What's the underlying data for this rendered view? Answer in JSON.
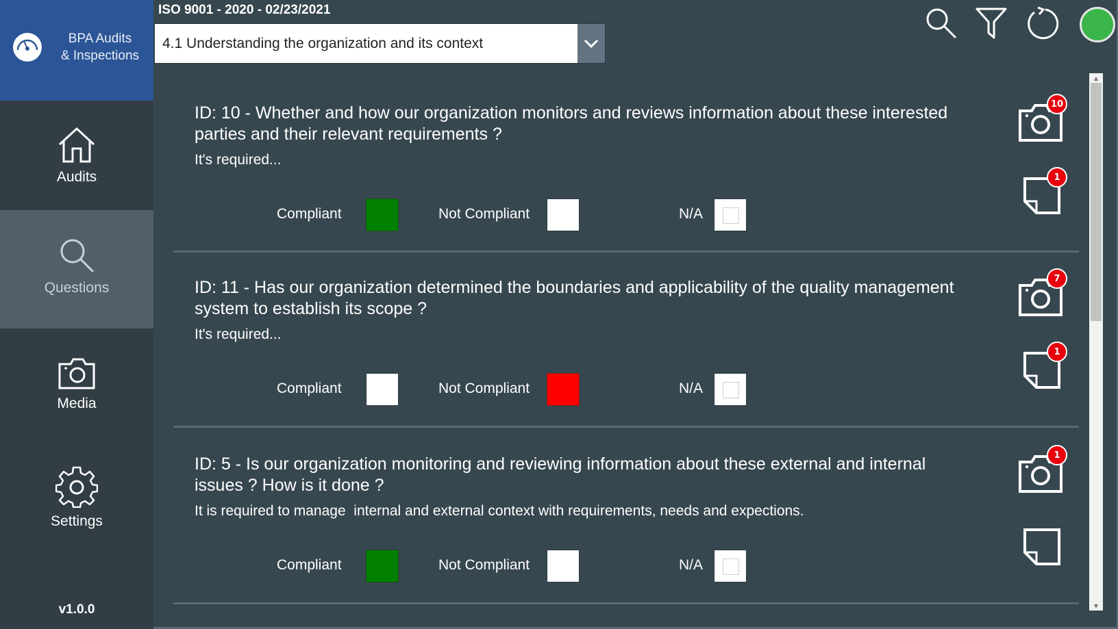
{
  "app": {
    "name_line1": "BPA Audits",
    "name_line2": "& Inspections",
    "version": "v1.0.0"
  },
  "sidebar": {
    "items": [
      {
        "label": "Audits",
        "icon": "home-icon",
        "active": false
      },
      {
        "label": "Questions",
        "icon": "search-icon",
        "active": true
      },
      {
        "label": "Media",
        "icon": "camera-icon",
        "active": false
      },
      {
        "label": "Settings",
        "icon": "gear-icon",
        "active": false
      }
    ]
  },
  "header": {
    "audit_title": "ISO 9001 - 2020 - 02/23/2021",
    "section_selected": "4.1 Understanding the organization and its context",
    "icons": [
      "search-icon",
      "filter-icon",
      "refresh-icon",
      "status-indicator"
    ],
    "status_color": "#39b54a"
  },
  "options": {
    "compliant": "Compliant",
    "not_compliant": "Not Compliant",
    "na": "N/A"
  },
  "colors": {
    "compliant": "#028002",
    "not_compliant": "#ff0000",
    "badge": "#e8000c",
    "brand": "#2b5596"
  },
  "questions": [
    {
      "title": "ID: 10 - Whether and how our organization monitors and reviews information about these interested parties and their relevant requirements ?",
      "description": "It's required...",
      "status": "compliant",
      "photo_count": "10",
      "note_count": "1"
    },
    {
      "title": "ID: 11 - Has our organization determined the boundaries and applicability of the quality management system to establish its scope ?",
      "description": "It's required...",
      "status": "not_compliant",
      "photo_count": "7",
      "note_count": "1"
    },
    {
      "title": "ID: 5 - Is our organization monitoring and reviewing information about these external and internal issues ? How is it done ?",
      "description": "It is required to manage  internal and external context with requirements, needs and expections.",
      "status": "compliant",
      "photo_count": "1",
      "note_count": null
    }
  ]
}
